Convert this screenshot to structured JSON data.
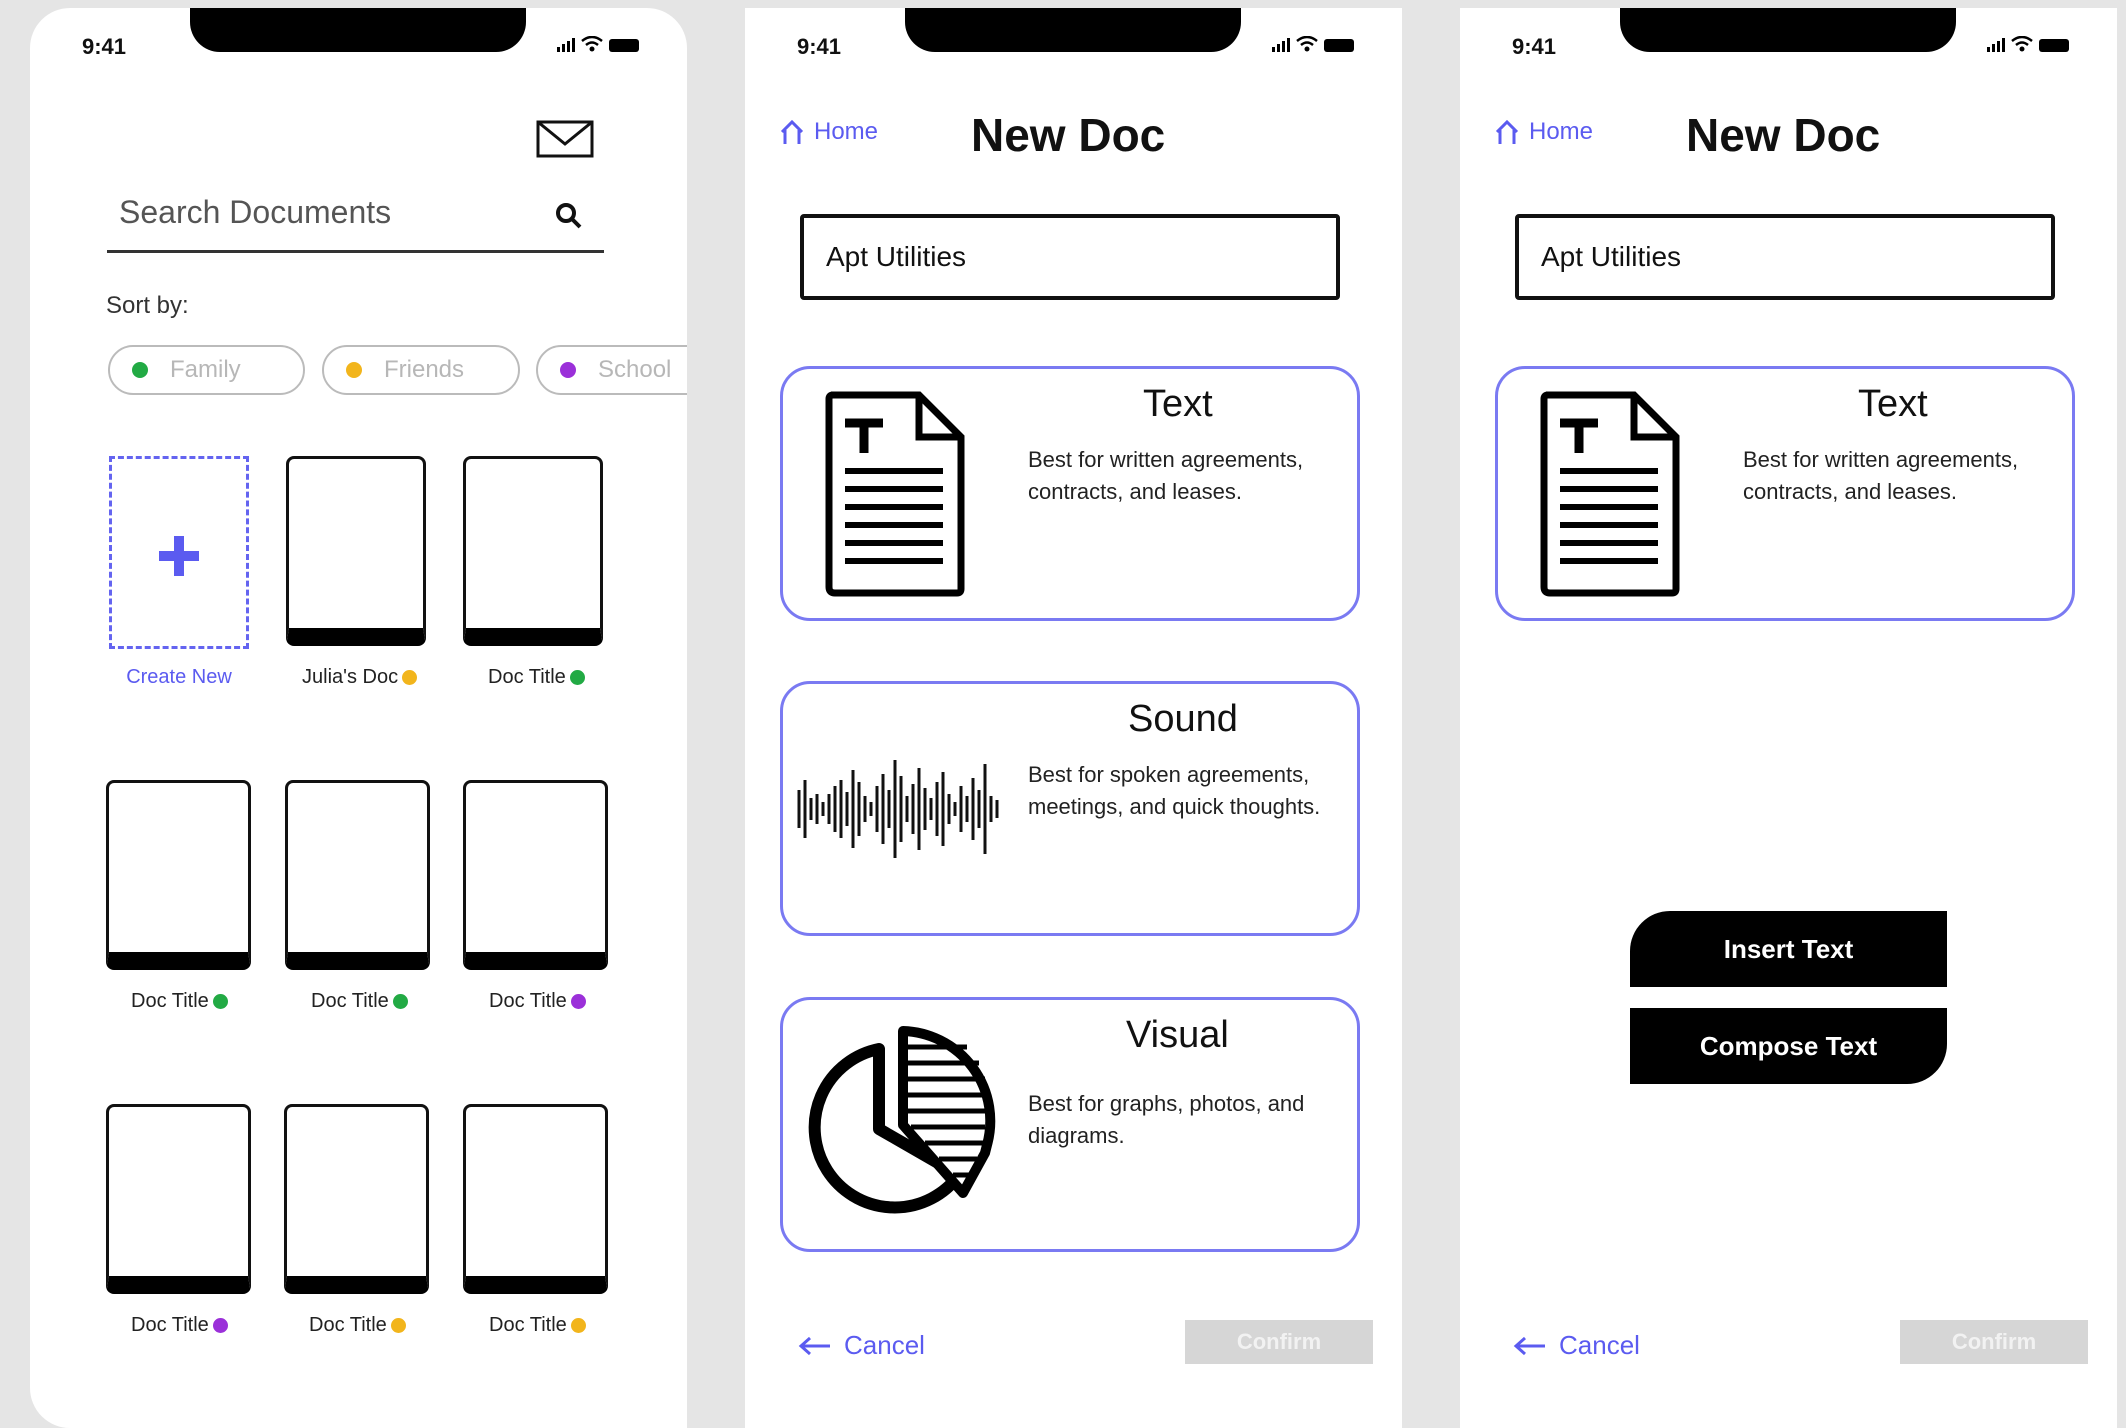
{
  "status_bar": {
    "time": "9:41"
  },
  "screen1": {
    "search_placeholder": "Search Documents",
    "sort_label": "Sort by:",
    "chips": [
      {
        "label": "Family",
        "color": "#22aa44"
      },
      {
        "label": "Friends",
        "color": "#f2b51c"
      },
      {
        "label": "School",
        "color": "#9b30d9"
      }
    ],
    "create_new": "Create New",
    "docs": [
      {
        "title": "Julia's Doc",
        "color": "#f2b51c"
      },
      {
        "title": "Doc Title",
        "color": "#22aa44"
      },
      {
        "title": "Doc Title",
        "color": "#22aa44"
      },
      {
        "title": "Doc Title",
        "color": "#22aa44"
      },
      {
        "title": "Doc Title",
        "color": "#9b30d9"
      },
      {
        "title": "Doc Title",
        "color": "#9b30d9"
      },
      {
        "title": "Doc Title",
        "color": "#f2b51c"
      },
      {
        "title": "Doc Title",
        "color": "#f2b51c"
      }
    ]
  },
  "new_doc": {
    "home_label": "Home",
    "title": "New Doc",
    "doc_name": "Apt Utilities",
    "types": [
      {
        "name": "Text",
        "desc": "Best for written agreements, contracts, and leases."
      },
      {
        "name": "Sound",
        "desc": "Best for spoken agreements, meetings, and quick thoughts."
      },
      {
        "name": "Visual",
        "desc": "Best for graphs, photos, and diagrams."
      }
    ],
    "cancel_label": "Cancel",
    "confirm_label": "Confirm"
  },
  "screen3": {
    "insert_text": "Insert Text",
    "compose_text": "Compose Text"
  },
  "colors": {
    "accent": "#5b5bf0",
    "card_border": "#7a7af2",
    "disabled": "#d6d6d6"
  }
}
